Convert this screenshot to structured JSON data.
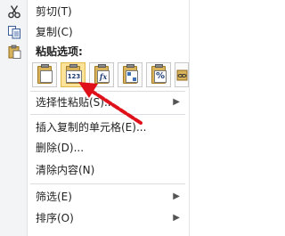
{
  "menu": {
    "cut": {
      "label": "剪切(T)",
      "icon": "scissors-icon"
    },
    "copy": {
      "label": "复制(C)",
      "icon": "copy-icon"
    },
    "paste_options_header": "粘贴选项:",
    "paste_buttons": [
      {
        "name": "paste-default",
        "text": ""
      },
      {
        "name": "paste-values",
        "text": "123"
      },
      {
        "name": "paste-formulas",
        "text": "fx"
      },
      {
        "name": "paste-transpose",
        "text": ""
      },
      {
        "name": "paste-formatting",
        "text": "%"
      },
      {
        "name": "paste-link",
        "text": ""
      }
    ],
    "paste_special": {
      "label": "选择性粘贴(S)..."
    },
    "insert_copied": {
      "label": "插入复制的单元格(E)..."
    },
    "delete": {
      "label": "删除(D)..."
    },
    "clear_contents": {
      "label": "清除内容(N)"
    },
    "filter": {
      "label": "筛选(E)"
    },
    "sort": {
      "label": "排序(O)"
    }
  },
  "annotation": {
    "arrow_color": "#e0101a"
  }
}
